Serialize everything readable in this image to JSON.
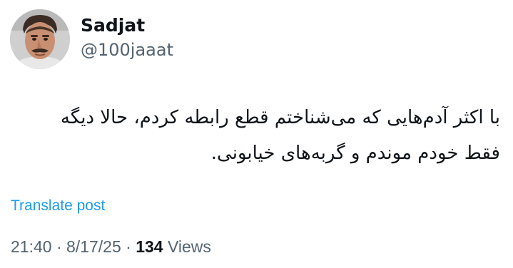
{
  "author": {
    "display_name": "Sadjat",
    "handle": "@100jaaat"
  },
  "post": {
    "lines": [
      "با اکثر آدم‌هایی که می‌شناختم قطع رابطه کردم، حالا دیگه",
      "فقط خودم موندم و گربه‌های خیابونی."
    ],
    "translate_label": "Translate post"
  },
  "meta": {
    "time": "21:40",
    "separator": "·",
    "date": "8/17/25",
    "views_count": "134",
    "views_label": "Views"
  },
  "colors": {
    "text": "#0f1419",
    "secondary": "#536471",
    "link": "#1d9bf0"
  }
}
